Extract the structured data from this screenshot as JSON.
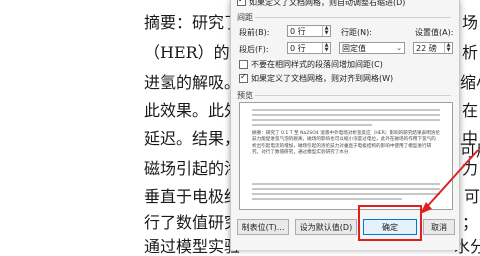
{
  "doc": {
    "lines": [
      {
        "left": "摘要：研究了",
        "right": "场"
      },
      {
        "left": "（HER）的影",
        "right": "析"
      },
      {
        "left": "进氢的解吸。",
        "right": "缩小"
      },
      {
        "left": "此效果。此外",
        "right": "在"
      },
      {
        "left": "延迟。结果，",
        "right": ""
      },
      {
        "left": "磁场引起的洛",
        "right": "力"
      },
      {
        "left": "垂直于电极结",
        "right": "可"
      },
      {
        "left": "行了数值研究",
        "right": "；"
      },
      {
        "left": "通过模型实验",
        "right": "水分"
      }
    ],
    "right_extra": [
      "中",
      "可用"
    ]
  },
  "dialog": {
    "top_checkbox_label": "如果定义了文档网格，则自动调整右缩进(D)",
    "spacing_section": "间距",
    "before_label": "段前(B):",
    "before_value": "0 行",
    "after_label": "段后(F):",
    "after_value": "0 行",
    "line_spacing_label": "行距(N):",
    "line_spacing_value": "固定值",
    "set_value_label": "设置值(A):",
    "set_value": "22 磅",
    "no_space_checkbox": "不要在相同样式的段落间增加间距(C)",
    "grid_checkbox": "如果定义了文档网格，则对齐到网格(W)",
    "preview_label": "预览",
    "preview_text": "摘要：研究了 0.1 T 至 Na2SO4 溶液中外电场对析氢反应（HER）影响的研究结果表明洛伦兹力能促进氢气泡的脱离，磁场的影响也可以缩小浓度过电位，此外在磁场的作用下氢气的析出引起电流的增加，磁场引起的洛伦兹力对垂直于电极结构的影响中使用了模型进行研究，对行了数值研究，通过模型实验研究了水分",
    "tabs_button": "制表位(T)...",
    "default_button": "设为默认值(D)",
    "ok_button": "确定",
    "cancel_button": "取消"
  },
  "colors": {
    "annotation": "#e02020",
    "primary_border": "#0078d7"
  }
}
